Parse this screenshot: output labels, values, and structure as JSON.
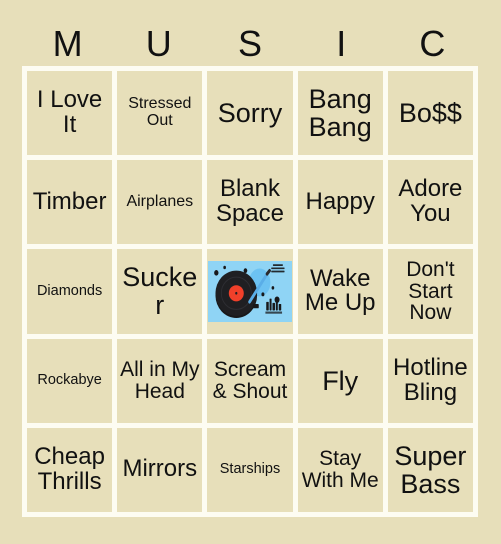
{
  "header": {
    "letters": [
      "M",
      "U",
      "S",
      "I",
      "C"
    ]
  },
  "grid": {
    "rows": [
      [
        {
          "text": "I Love It",
          "size": "fs-lg"
        },
        {
          "text": "Stressed Out",
          "size": "fs-sm"
        },
        {
          "text": "Sorry",
          "size": "fs-xl"
        },
        {
          "text": "Bang Bang",
          "size": "fs-xl"
        },
        {
          "text": "Bo$$",
          "size": "fs-xl"
        }
      ],
      [
        {
          "text": "Timber",
          "size": "fs-lg"
        },
        {
          "text": "Airplanes",
          "size": "fs-sm"
        },
        {
          "text": "Blank Space",
          "size": "fs-lg"
        },
        {
          "text": "Happy",
          "size": "fs-lg"
        },
        {
          "text": "Adore You",
          "size": "fs-lg"
        }
      ],
      [
        {
          "text": "Diamonds",
          "size": "fs-xs"
        },
        {
          "text": "Sucker",
          "size": "fs-xl"
        },
        {
          "text": "",
          "size": "free",
          "image": "record-player-free-space"
        },
        {
          "text": "Wake Me Up",
          "size": "fs-lg"
        },
        {
          "text": "Don't Start Now",
          "size": "fs-md"
        }
      ],
      [
        {
          "text": "Rockabye",
          "size": "fs-xs"
        },
        {
          "text": "All in My Head",
          "size": "fs-md"
        },
        {
          "text": "Scream & Shout",
          "size": "fs-md"
        },
        {
          "text": "Fly",
          "size": "fs-xl"
        },
        {
          "text": "Hotline Bling",
          "size": "fs-lg"
        }
      ],
      [
        {
          "text": "Cheap Thrills",
          "size": "fs-lg"
        },
        {
          "text": "Mirrors",
          "size": "fs-lg"
        },
        {
          "text": "Starships",
          "size": "fs-xs"
        },
        {
          "text": "Stay With Me",
          "size": "fs-md"
        },
        {
          "text": "Super Bass",
          "size": "fs-xl"
        }
      ]
    ]
  },
  "colors": {
    "page_background": "#e7dfba",
    "cell_background": "#e7dfba",
    "grid_line": "#fdfcf2",
    "text": "#111111",
    "free_space_background": "#8fd4f5",
    "record_vinyl": "#1a1a1a",
    "record_label": "#f0402a",
    "tonearm": "#5aaee8"
  }
}
